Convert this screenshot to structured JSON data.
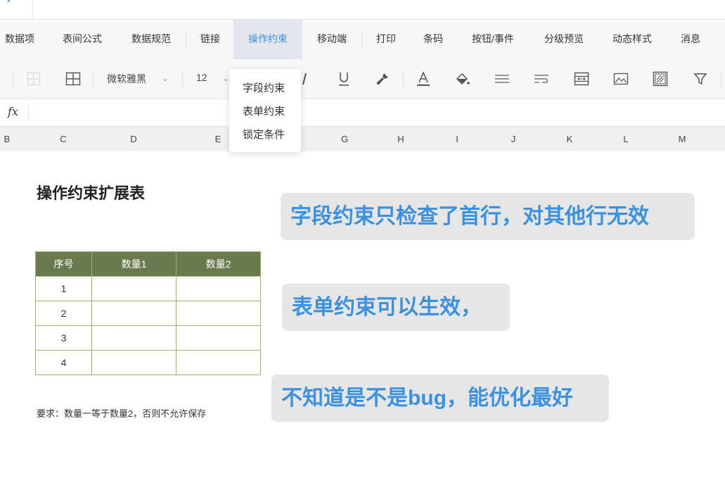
{
  "topbar": {
    "close_glyph": "×"
  },
  "menubar": {
    "items": [
      "数据项",
      "表间公式",
      "数据规范",
      "链接",
      "操作约束",
      "移动端",
      "打印",
      "条码",
      "按钮/事件",
      "分级预览",
      "动态样式",
      "消息"
    ],
    "active_item": "操作约束",
    "accent_color": "#3d8fe0"
  },
  "toolbar": {
    "font_name": "微软雅黑",
    "font_size": "12",
    "icons": [
      "cell-border-icon",
      "table-grid-icon",
      "italic-icon",
      "underline-icon",
      "format-painter-icon",
      "font-color-icon",
      "fill-color-icon",
      "align-icon",
      "wrap-text-icon",
      "merge-cells-icon",
      "image-icon",
      "frame-icon",
      "filter-icon"
    ]
  },
  "formula_bar": {
    "fx_label": "fx"
  },
  "columns": [
    "B",
    "C",
    "D",
    "E",
    "G",
    "H",
    "I",
    "J",
    "K",
    "L",
    "M"
  ],
  "dropdown": {
    "items": [
      "字段约束",
      "表单约束",
      "锁定条件"
    ]
  },
  "sheet": {
    "title": "操作约束扩展表",
    "table": {
      "headers": [
        "序号",
        "数量1",
        "数量2"
      ],
      "rows": [
        [
          "1",
          "",
          ""
        ],
        [
          "2",
          "",
          ""
        ],
        [
          "3",
          "",
          ""
        ],
        [
          "4",
          "",
          ""
        ]
      ],
      "header_color": "#6b7a4e",
      "border_color": "#9fb26b"
    },
    "note": "要求：数量一等于数量2，否则不允许保存"
  },
  "callouts": [
    "字段约束只检查了首行，对其他行无效",
    "表单约束可以生效，",
    "不知道是不是bug，能优化最好"
  ],
  "callout_color": "#3b91de"
}
